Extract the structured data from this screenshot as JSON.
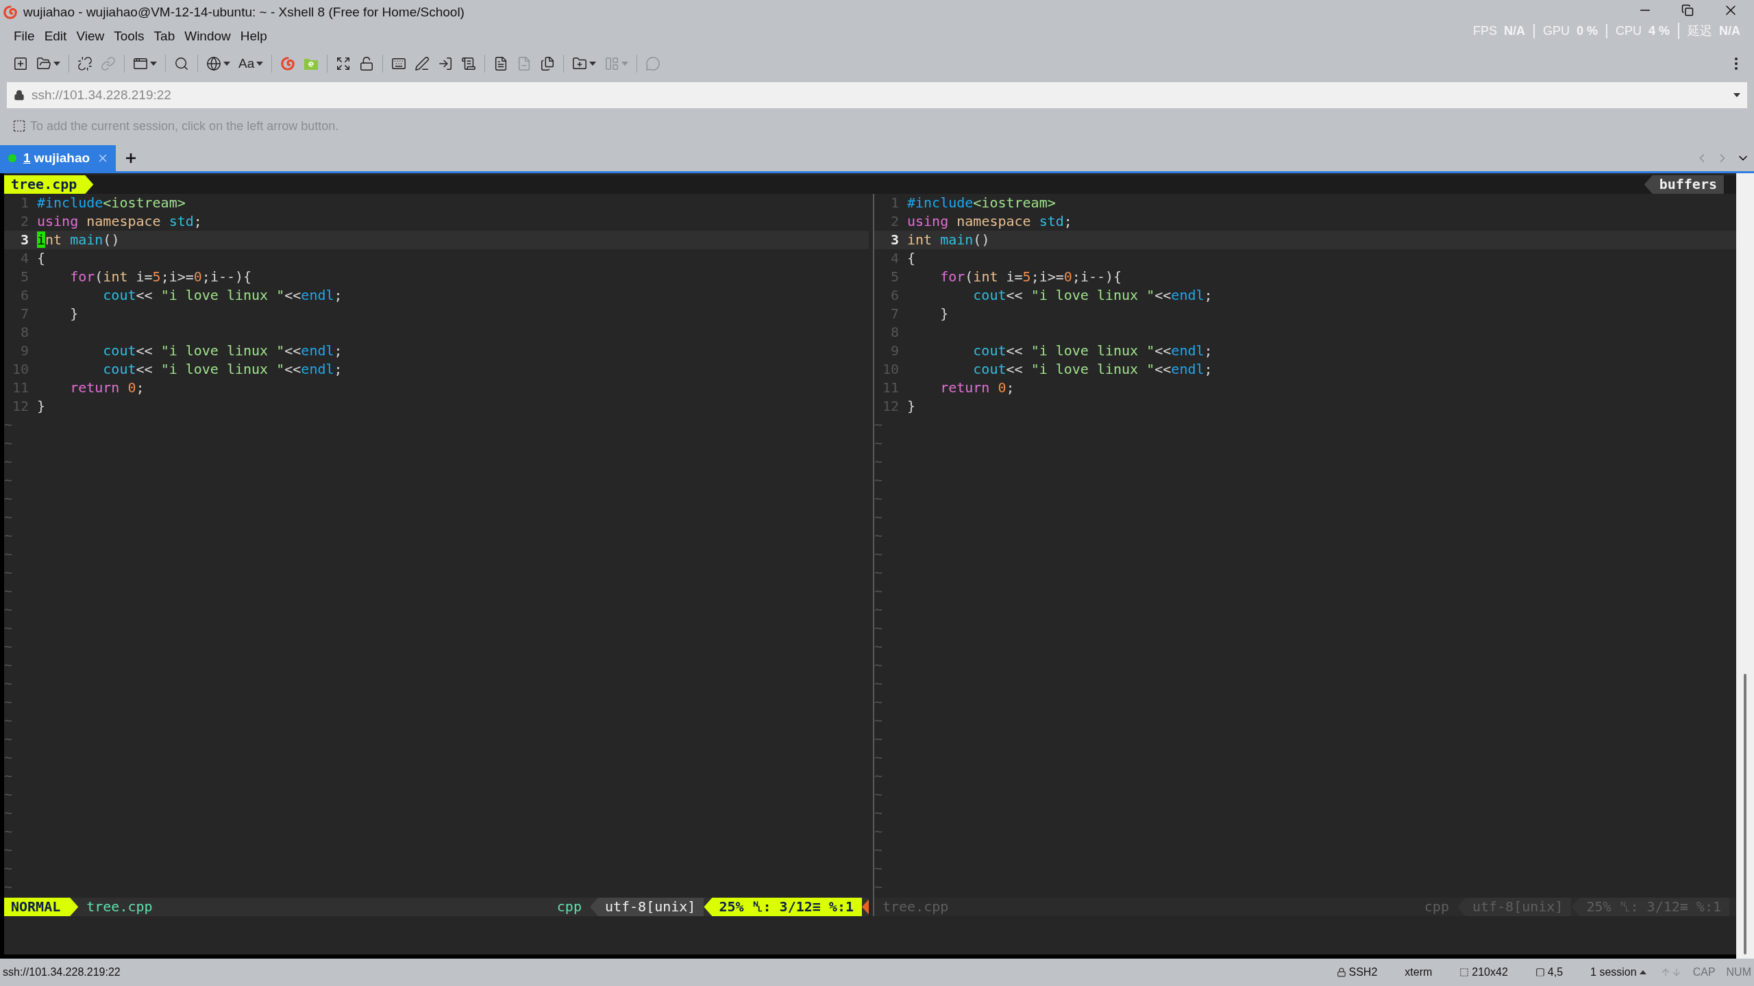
{
  "window": {
    "title": "wujiahao - wujiahao@VM-12-14-ubuntu: ~ - Xshell 8 (Free for Home/School)"
  },
  "perf": [
    {
      "label": "FPS",
      "value": "N/A"
    },
    {
      "label": "GPU",
      "value": "0 %"
    },
    {
      "label": "CPU",
      "value": "4 %"
    },
    {
      "label": "延迟",
      "value": "N/A"
    }
  ],
  "menu": [
    "File",
    "Edit",
    "View",
    "Tools",
    "Tab",
    "Window",
    "Help"
  ],
  "toolbar": [
    {
      "kind": "new-session"
    },
    {
      "kind": "open",
      "dropdown": true
    },
    {
      "kind": "sep"
    },
    {
      "kind": "disconnect"
    },
    {
      "kind": "link",
      "disabled": true
    },
    {
      "kind": "sep"
    },
    {
      "kind": "properties",
      "dropdown": true
    },
    {
      "kind": "sep"
    },
    {
      "kind": "find"
    },
    {
      "kind": "sep"
    },
    {
      "kind": "globe",
      "dropdown": true
    },
    {
      "kind": "font",
      "label": "Aa",
      "dropdown": true
    },
    {
      "kind": "sep"
    },
    {
      "kind": "xshell"
    },
    {
      "kind": "xftp"
    },
    {
      "kind": "sep"
    },
    {
      "kind": "fullscreen"
    },
    {
      "kind": "lock"
    },
    {
      "kind": "sep"
    },
    {
      "kind": "keyboard"
    },
    {
      "kind": "compose"
    },
    {
      "kind": "transfer"
    },
    {
      "kind": "script"
    },
    {
      "kind": "sep"
    },
    {
      "kind": "log-start"
    },
    {
      "kind": "log-stop",
      "disabled": true
    },
    {
      "kind": "notes"
    },
    {
      "kind": "sep"
    },
    {
      "kind": "new-folder",
      "dropdown": true
    },
    {
      "kind": "layout",
      "dropdown": true,
      "disabled": true
    },
    {
      "kind": "sep"
    },
    {
      "kind": "chat",
      "disabled": true
    }
  ],
  "address": {
    "value": "ssh://101.34.228.219:22"
  },
  "hint": "To add the current session, click on the left arrow button.",
  "tabs": [
    {
      "number": "1",
      "label": "wujiahao",
      "selected": true,
      "color": "#1ed21e"
    }
  ],
  "vim": {
    "tabline": {
      "buffer": "tree.cpp",
      "right": "buffers"
    },
    "panes": [
      {
        "active": true,
        "lines": [
          {
            "num": "1",
            "current": false,
            "cursor": false,
            "tokens": [
              {
                "kind": "include",
                "text": "#include"
              },
              {
                "kind": "header",
                "text": "<iostream>"
              }
            ]
          },
          {
            "num": "2",
            "current": false,
            "cursor": false,
            "tokens": [
              {
                "kind": "keyword",
                "text": "using"
              },
              {
                "kind": "type",
                "text": " namespace"
              },
              {
                "kind": "ident",
                "text": " std"
              },
              {
                "kind": "plain",
                "text": ";"
              }
            ]
          },
          {
            "num": "3",
            "current": true,
            "cursor": true,
            "tokens": [
              {
                "kind": "type",
                "text": "int"
              },
              {
                "kind": "ident",
                "text": " main"
              },
              {
                "kind": "plain",
                "text": "()"
              }
            ]
          },
          {
            "num": "4",
            "current": false,
            "cursor": false,
            "tokens": [
              {
                "kind": "plain",
                "text": "{"
              }
            ]
          },
          {
            "num": "5",
            "current": false,
            "cursor": false,
            "tokens": [
              {
                "kind": "keyword",
                "text": "    for"
              },
              {
                "kind": "plain",
                "text": "("
              },
              {
                "kind": "type",
                "text": "int"
              },
              {
                "kind": "plain",
                "text": " i="
              },
              {
                "kind": "number",
                "text": "5"
              },
              {
                "kind": "plain",
                "text": ";i>="
              },
              {
                "kind": "number",
                "text": "0"
              },
              {
                "kind": "plain",
                "text": ";i--){"
              }
            ]
          },
          {
            "num": "6",
            "current": false,
            "cursor": false,
            "tokens": [
              {
                "kind": "ident",
                "text": "        cout"
              },
              {
                "kind": "plain",
                "text": "<< "
              },
              {
                "kind": "string",
                "text": "\"i love linux \""
              },
              {
                "kind": "plain",
                "text": "<<"
              },
              {
                "kind": "include",
                "text": "endl"
              },
              {
                "kind": "plain",
                "text": ";"
              }
            ]
          },
          {
            "num": "7",
            "current": false,
            "cursor": false,
            "tokens": [
              {
                "kind": "plain",
                "text": "    }"
              }
            ]
          },
          {
            "num": "8",
            "current": false,
            "cursor": false
          },
          {
            "num": "9",
            "current": false,
            "cursor": false,
            "tokens": [
              {
                "kind": "ident",
                "text": "        cout"
              },
              {
                "kind": "plain",
                "text": "<< "
              },
              {
                "kind": "string",
                "text": "\"i love linux \""
              },
              {
                "kind": "plain",
                "text": "<<"
              },
              {
                "kind": "include",
                "text": "endl"
              },
              {
                "kind": "plain",
                "text": ";"
              }
            ]
          },
          {
            "num": "10",
            "current": false,
            "cursor": false,
            "tokens": [
              {
                "kind": "ident",
                "text": "        cout"
              },
              {
                "kind": "plain",
                "text": "<< "
              },
              {
                "kind": "string",
                "text": "\"i love linux \""
              },
              {
                "kind": "plain",
                "text": "<<"
              },
              {
                "kind": "include",
                "text": "endl"
              },
              {
                "kind": "plain",
                "text": ";"
              }
            ]
          },
          {
            "num": "11",
            "current": false,
            "cursor": false,
            "tokens": [
              {
                "kind": "keyword",
                "text": "    return"
              },
              {
                "kind": "number",
                "text": " 0"
              },
              {
                "kind": "plain",
                "text": ";"
              }
            ]
          },
          {
            "num": "12",
            "current": false,
            "cursor": false,
            "tokens": [
              {
                "kind": "plain",
                "text": "}"
              }
            ]
          }
        ],
        "filler": [
          "~",
          "~",
          "~",
          "~",
          "~",
          "~",
          "~",
          "~",
          "~",
          "~",
          "~",
          "~",
          "~",
          "~",
          "~",
          "~",
          "~",
          "~",
          "~",
          "~",
          "~",
          "~",
          "~",
          "~",
          "~",
          "~"
        ],
        "status": {
          "mode": "NORMAL",
          "file": "tree.cpp",
          "filetype": "cpp",
          "encoding": "utf-8[unix]",
          "position": "25% ␤: 3/12≡ %:1"
        }
      },
      {
        "active": false,
        "lines": [
          {
            "num": "1",
            "current": false,
            "cursor": false,
            "tokens": [
              {
                "kind": "include",
                "text": "#include"
              },
              {
                "kind": "header",
                "text": "<iostream>"
              }
            ]
          },
          {
            "num": "2",
            "current": false,
            "cursor": false,
            "tokens": [
              {
                "kind": "keyword",
                "text": "using"
              },
              {
                "kind": "type",
                "text": " namespace"
              },
              {
                "kind": "ident",
                "text": " std"
              },
              {
                "kind": "plain",
                "text": ";"
              }
            ]
          },
          {
            "num": "3",
            "current": true,
            "cursor": false,
            "tokens": [
              {
                "kind": "type",
                "text": "int"
              },
              {
                "kind": "ident",
                "text": " main"
              },
              {
                "kind": "plain",
                "text": "()"
              }
            ]
          },
          {
            "num": "4",
            "current": false,
            "cursor": false,
            "tokens": [
              {
                "kind": "plain",
                "text": "{"
              }
            ]
          },
          {
            "num": "5",
            "current": false,
            "cursor": false,
            "tokens": [
              {
                "kind": "keyword",
                "text": "    for"
              },
              {
                "kind": "plain",
                "text": "("
              },
              {
                "kind": "type",
                "text": "int"
              },
              {
                "kind": "plain",
                "text": " i="
              },
              {
                "kind": "number",
                "text": "5"
              },
              {
                "kind": "plain",
                "text": ";i>="
              },
              {
                "kind": "number",
                "text": "0"
              },
              {
                "kind": "plain",
                "text": ";i--){"
              }
            ]
          },
          {
            "num": "6",
            "current": false,
            "cursor": false,
            "tokens": [
              {
                "kind": "ident",
                "text": "        cout"
              },
              {
                "kind": "plain",
                "text": "<< "
              },
              {
                "kind": "string",
                "text": "\"i love linux \""
              },
              {
                "kind": "plain",
                "text": "<<"
              },
              {
                "kind": "include",
                "text": "endl"
              },
              {
                "kind": "plain",
                "text": ";"
              }
            ]
          },
          {
            "num": "7",
            "current": false,
            "cursor": false,
            "tokens": [
              {
                "kind": "plain",
                "text": "    }"
              }
            ]
          },
          {
            "num": "8",
            "current": false,
            "cursor": false
          },
          {
            "num": "9",
            "current": false,
            "cursor": false,
            "tokens": [
              {
                "kind": "ident",
                "text": "        cout"
              },
              {
                "kind": "plain",
                "text": "<< "
              },
              {
                "kind": "string",
                "text": "\"i love linux \""
              },
              {
                "kind": "plain",
                "text": "<<"
              },
              {
                "kind": "include",
                "text": "endl"
              },
              {
                "kind": "plain",
                "text": ";"
              }
            ]
          },
          {
            "num": "10",
            "current": false,
            "cursor": false,
            "tokens": [
              {
                "kind": "ident",
                "text": "        cout"
              },
              {
                "kind": "plain",
                "text": "<< "
              },
              {
                "kind": "string",
                "text": "\"i love linux \""
              },
              {
                "kind": "plain",
                "text": "<<"
              },
              {
                "kind": "include",
                "text": "endl"
              },
              {
                "kind": "plain",
                "text": ";"
              }
            ]
          },
          {
            "num": "11",
            "current": false,
            "cursor": false,
            "tokens": [
              {
                "kind": "keyword",
                "text": "    return"
              },
              {
                "kind": "number",
                "text": " 0"
              },
              {
                "kind": "plain",
                "text": ";"
              }
            ]
          },
          {
            "num": "12",
            "current": false,
            "cursor": false,
            "tokens": [
              {
                "kind": "plain",
                "text": "}"
              }
            ]
          }
        ],
        "filler": [
          "~",
          "~",
          "~",
          "~",
          "~",
          "~",
          "~",
          "~",
          "~",
          "~",
          "~",
          "~",
          "~",
          "~",
          "~",
          "~",
          "~",
          "~",
          "~",
          "~",
          "~",
          "~",
          "~",
          "~",
          "~",
          "~"
        ],
        "status": {
          "file": "tree.cpp",
          "filetype": "cpp",
          "encoding": "utf-8[unix]",
          "position": "25% ␤: 3/12≡ %:1"
        }
      }
    ]
  },
  "status_bar": {
    "address": "ssh://101.34.228.219:22",
    "items": [
      {
        "kind": "protocol",
        "text": "SSH2"
      },
      {
        "kind": "terminal",
        "text": "xterm"
      },
      {
        "kind": "size",
        "text": "210x42"
      },
      {
        "kind": "cursor",
        "text": "4,5"
      },
      {
        "kind": "sessions",
        "text": "1 session"
      }
    ],
    "indicators": [
      {
        "label": "CAP",
        "on": false
      },
      {
        "label": "NUM",
        "on": false
      }
    ]
  }
}
